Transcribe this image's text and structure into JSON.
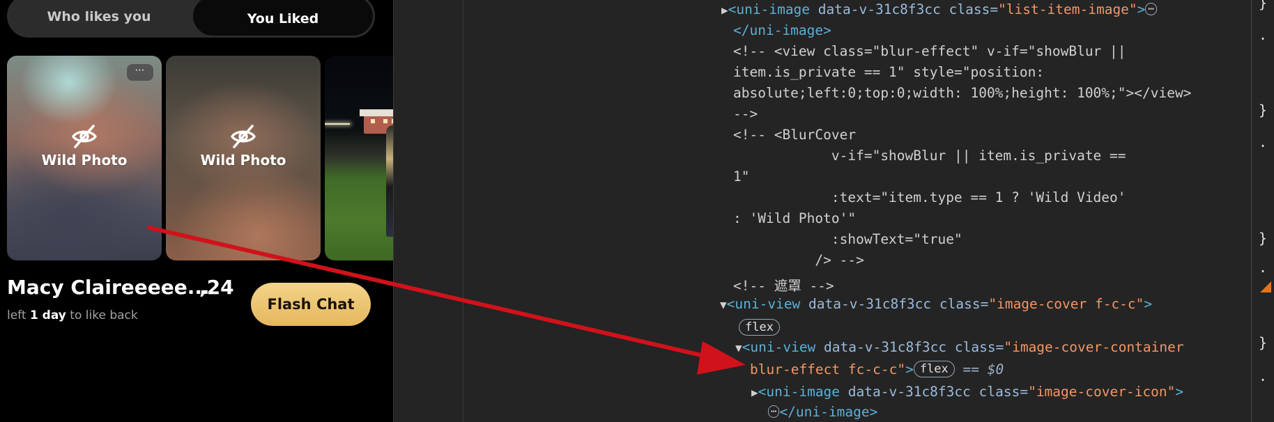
{
  "tabs": {
    "who_likes": "Who likes you",
    "you_liked": "You Liked"
  },
  "cards": [
    {
      "cover_text": "Wild Photo",
      "more_label": "⋯"
    },
    {
      "cover_text": "Wild Photo"
    }
  ],
  "profile": {
    "name": "Macy Claireeeee...",
    "age": ",24",
    "sub_prefix": "left ",
    "sub_bold": "1 day",
    "sub_suffix": " to like back",
    "flash_chat": "Flash Chat"
  },
  "devtools": {
    "l1": {
      "tag_open": "<uni-image",
      "attr": " data-v-31c8f3cc",
      "cls_key": " class=",
      "cls_val": "\"list-item-image\"",
      "tag_close": ">"
    },
    "l2": "</uni-image>",
    "l3": "<!-- <view class=\"blur-effect\" v-if=\"showBlur ||",
    "l4": "item.is_private == 1\" style=\"position:",
    "l5": "absolute;left:0;top:0;width: 100%;height: 100%;\"></view>",
    "l6": "-->",
    "l7": "<!-- <BlurCover",
    "l8": "            v-if=\"showBlur || item.is_private ==",
    "l9": "1\"",
    "l10": "            :text=\"item.type == 1 ? 'Wild Video'",
    "l11": ": 'Wild Photo'\"",
    "l12": "            :showText=\"true\"",
    "l13": "          /> -->",
    "l14": "<!-- 遮罩 -->",
    "l15": {
      "tag_open": "<uni-view",
      "attr": " data-v-31c8f3cc",
      "cls_key": " class=",
      "cls_val": "\"image-cover f-c-c\"",
      "tag_close": ">"
    },
    "flex1": "flex",
    "l17": {
      "tag_open": "<uni-view",
      "attr": " data-v-31c8f3cc",
      "cls_key": " class=",
      "cls_val": "\"image-cover-container"
    },
    "l18": {
      "cls_val": "blur-effect fc-c-c\"",
      "tag_close": ">"
    },
    "flex2": "flex",
    "dollar": "== $0",
    "l19": {
      "tag_open": "<uni-image",
      "attr": " data-v-31c8f3cc",
      "cls_key": " class=",
      "cls_val": "\"image-cover-icon\"",
      "tag_close": ">"
    },
    "l20": "</uni-image>",
    "ellipsis": "⋯",
    "gutter_dots": "•••"
  },
  "right_strip": [
    "}",
    ".",
    "}",
    ".",
    "}",
    ".",
    "}",
    "."
  ]
}
